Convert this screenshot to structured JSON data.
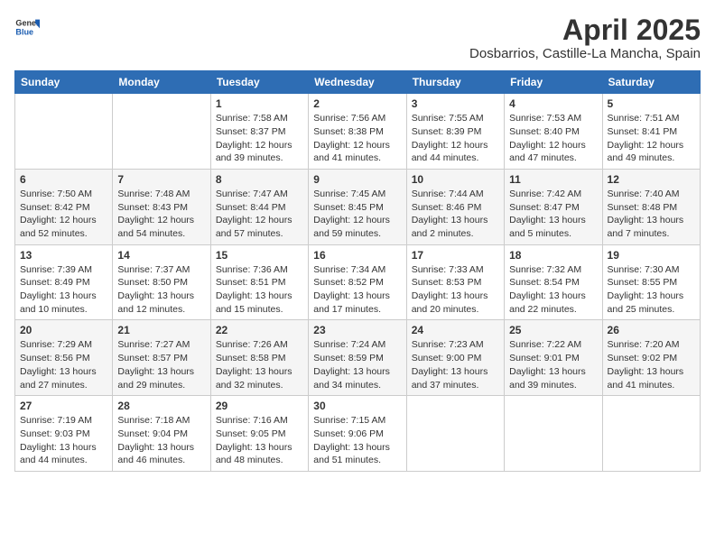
{
  "header": {
    "logo_general": "General",
    "logo_blue": "Blue",
    "title": "April 2025",
    "subtitle": "Dosbarrios, Castille-La Mancha, Spain"
  },
  "calendar": {
    "days_of_week": [
      "Sunday",
      "Monday",
      "Tuesday",
      "Wednesday",
      "Thursday",
      "Friday",
      "Saturday"
    ],
    "weeks": [
      [
        {
          "day": "",
          "info": ""
        },
        {
          "day": "",
          "info": ""
        },
        {
          "day": "1",
          "info": "Sunrise: 7:58 AM\nSunset: 8:37 PM\nDaylight: 12 hours and 39 minutes."
        },
        {
          "day": "2",
          "info": "Sunrise: 7:56 AM\nSunset: 8:38 PM\nDaylight: 12 hours and 41 minutes."
        },
        {
          "day": "3",
          "info": "Sunrise: 7:55 AM\nSunset: 8:39 PM\nDaylight: 12 hours and 44 minutes."
        },
        {
          "day": "4",
          "info": "Sunrise: 7:53 AM\nSunset: 8:40 PM\nDaylight: 12 hours and 47 minutes."
        },
        {
          "day": "5",
          "info": "Sunrise: 7:51 AM\nSunset: 8:41 PM\nDaylight: 12 hours and 49 minutes."
        }
      ],
      [
        {
          "day": "6",
          "info": "Sunrise: 7:50 AM\nSunset: 8:42 PM\nDaylight: 12 hours and 52 minutes."
        },
        {
          "day": "7",
          "info": "Sunrise: 7:48 AM\nSunset: 8:43 PM\nDaylight: 12 hours and 54 minutes."
        },
        {
          "day": "8",
          "info": "Sunrise: 7:47 AM\nSunset: 8:44 PM\nDaylight: 12 hours and 57 minutes."
        },
        {
          "day": "9",
          "info": "Sunrise: 7:45 AM\nSunset: 8:45 PM\nDaylight: 12 hours and 59 minutes."
        },
        {
          "day": "10",
          "info": "Sunrise: 7:44 AM\nSunset: 8:46 PM\nDaylight: 13 hours and 2 minutes."
        },
        {
          "day": "11",
          "info": "Sunrise: 7:42 AM\nSunset: 8:47 PM\nDaylight: 13 hours and 5 minutes."
        },
        {
          "day": "12",
          "info": "Sunrise: 7:40 AM\nSunset: 8:48 PM\nDaylight: 13 hours and 7 minutes."
        }
      ],
      [
        {
          "day": "13",
          "info": "Sunrise: 7:39 AM\nSunset: 8:49 PM\nDaylight: 13 hours and 10 minutes."
        },
        {
          "day": "14",
          "info": "Sunrise: 7:37 AM\nSunset: 8:50 PM\nDaylight: 13 hours and 12 minutes."
        },
        {
          "day": "15",
          "info": "Sunrise: 7:36 AM\nSunset: 8:51 PM\nDaylight: 13 hours and 15 minutes."
        },
        {
          "day": "16",
          "info": "Sunrise: 7:34 AM\nSunset: 8:52 PM\nDaylight: 13 hours and 17 minutes."
        },
        {
          "day": "17",
          "info": "Sunrise: 7:33 AM\nSunset: 8:53 PM\nDaylight: 13 hours and 20 minutes."
        },
        {
          "day": "18",
          "info": "Sunrise: 7:32 AM\nSunset: 8:54 PM\nDaylight: 13 hours and 22 minutes."
        },
        {
          "day": "19",
          "info": "Sunrise: 7:30 AM\nSunset: 8:55 PM\nDaylight: 13 hours and 25 minutes."
        }
      ],
      [
        {
          "day": "20",
          "info": "Sunrise: 7:29 AM\nSunset: 8:56 PM\nDaylight: 13 hours and 27 minutes."
        },
        {
          "day": "21",
          "info": "Sunrise: 7:27 AM\nSunset: 8:57 PM\nDaylight: 13 hours and 29 minutes."
        },
        {
          "day": "22",
          "info": "Sunrise: 7:26 AM\nSunset: 8:58 PM\nDaylight: 13 hours and 32 minutes."
        },
        {
          "day": "23",
          "info": "Sunrise: 7:24 AM\nSunset: 8:59 PM\nDaylight: 13 hours and 34 minutes."
        },
        {
          "day": "24",
          "info": "Sunrise: 7:23 AM\nSunset: 9:00 PM\nDaylight: 13 hours and 37 minutes."
        },
        {
          "day": "25",
          "info": "Sunrise: 7:22 AM\nSunset: 9:01 PM\nDaylight: 13 hours and 39 minutes."
        },
        {
          "day": "26",
          "info": "Sunrise: 7:20 AM\nSunset: 9:02 PM\nDaylight: 13 hours and 41 minutes."
        }
      ],
      [
        {
          "day": "27",
          "info": "Sunrise: 7:19 AM\nSunset: 9:03 PM\nDaylight: 13 hours and 44 minutes."
        },
        {
          "day": "28",
          "info": "Sunrise: 7:18 AM\nSunset: 9:04 PM\nDaylight: 13 hours and 46 minutes."
        },
        {
          "day": "29",
          "info": "Sunrise: 7:16 AM\nSunset: 9:05 PM\nDaylight: 13 hours and 48 minutes."
        },
        {
          "day": "30",
          "info": "Sunrise: 7:15 AM\nSunset: 9:06 PM\nDaylight: 13 hours and 51 minutes."
        },
        {
          "day": "",
          "info": ""
        },
        {
          "day": "",
          "info": ""
        },
        {
          "day": "",
          "info": ""
        }
      ]
    ]
  }
}
